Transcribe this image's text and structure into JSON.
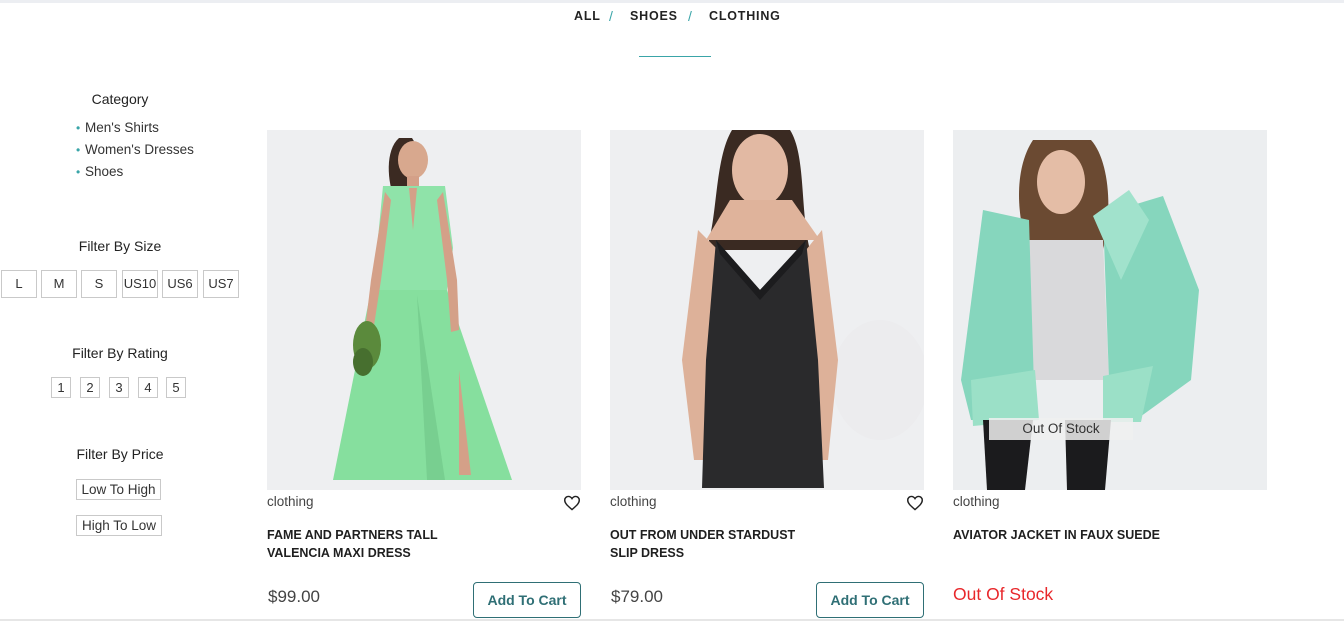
{
  "nav": {
    "all": "ALL",
    "sep1": "/",
    "shoes": "SHOES",
    "sep2": "/",
    "clothing": "CLOTHING"
  },
  "sidebar": {
    "category_heading": "Category",
    "categories": [
      "Men's Shirts",
      "Women's Dresses",
      "Shoes"
    ],
    "size_heading": "Filter By Size",
    "sizes": [
      "L",
      "M",
      "S",
      "US10",
      "US6",
      "US7"
    ],
    "rating_heading": "Filter By Rating",
    "ratings": [
      "1",
      "2",
      "3",
      "4",
      "5"
    ],
    "price_heading": "Filter By Price",
    "price_low_high": "Low To High",
    "price_high_low": "High To Low"
  },
  "products": [
    {
      "category": "clothing",
      "title_line1": "FAME AND PARTNERS TALL",
      "title_line2": "VALENCIA MAXI DRESS",
      "price": "$99.00",
      "button": "Add To Cart"
    },
    {
      "category": "clothing",
      "title_line1": "OUT FROM UNDER STARDUST",
      "title_line2": "SLIP DRESS",
      "price": "$79.00",
      "button": "Add To Cart"
    },
    {
      "category": "clothing",
      "title_line1": "AVIATOR JACKET IN FAUX SUEDE",
      "title_line2": "",
      "overlay": "Out Of Stock",
      "stock_status": "Out Of Stock"
    }
  ],
  "colors": {
    "accent": "#3aa5a8",
    "button": "#2f6f75",
    "out_of_stock": "#e8272b"
  },
  "icons": {
    "wishlist": "heart-outline-icon"
  }
}
